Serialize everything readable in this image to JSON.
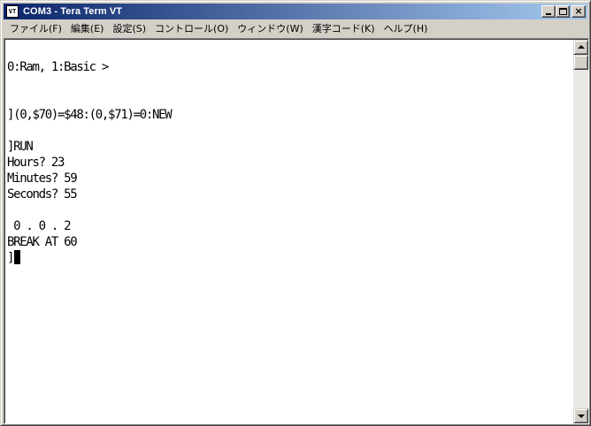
{
  "window": {
    "title": "COM3 - Tera Term VT",
    "icon_label": "VT",
    "icon": "teraterm-icon"
  },
  "title_buttons": {
    "minimize_icon": "minimize-icon",
    "maximize_icon": "maximize-icon",
    "close_icon": "close-icon",
    "close_glyph": "×"
  },
  "menu": {
    "items": [
      {
        "label": "ファイル(F)"
      },
      {
        "label": "編集(E)"
      },
      {
        "label": "設定(S)"
      },
      {
        "label": "コントロール(O)"
      },
      {
        "label": "ウィンドウ(W)"
      },
      {
        "label": "漢字コード(K)"
      },
      {
        "label": "ヘルプ(H)"
      }
    ]
  },
  "terminal": {
    "lines": [
      "",
      "0:Ram, 1:Basic >",
      "",
      "",
      "](0,$70)=$48:(0,$71)=0:NEW",
      "",
      "]RUN",
      "Hours? 23",
      "Minutes? 59",
      "Seconds? 55",
      "",
      " 0 . 0 . 2",
      "BREAK AT 60",
      "]"
    ],
    "cursor": "block-cursor"
  },
  "scrollbar": {
    "up_icon": "scroll-up-arrow-icon",
    "down_icon": "scroll-down-arrow-icon"
  }
}
